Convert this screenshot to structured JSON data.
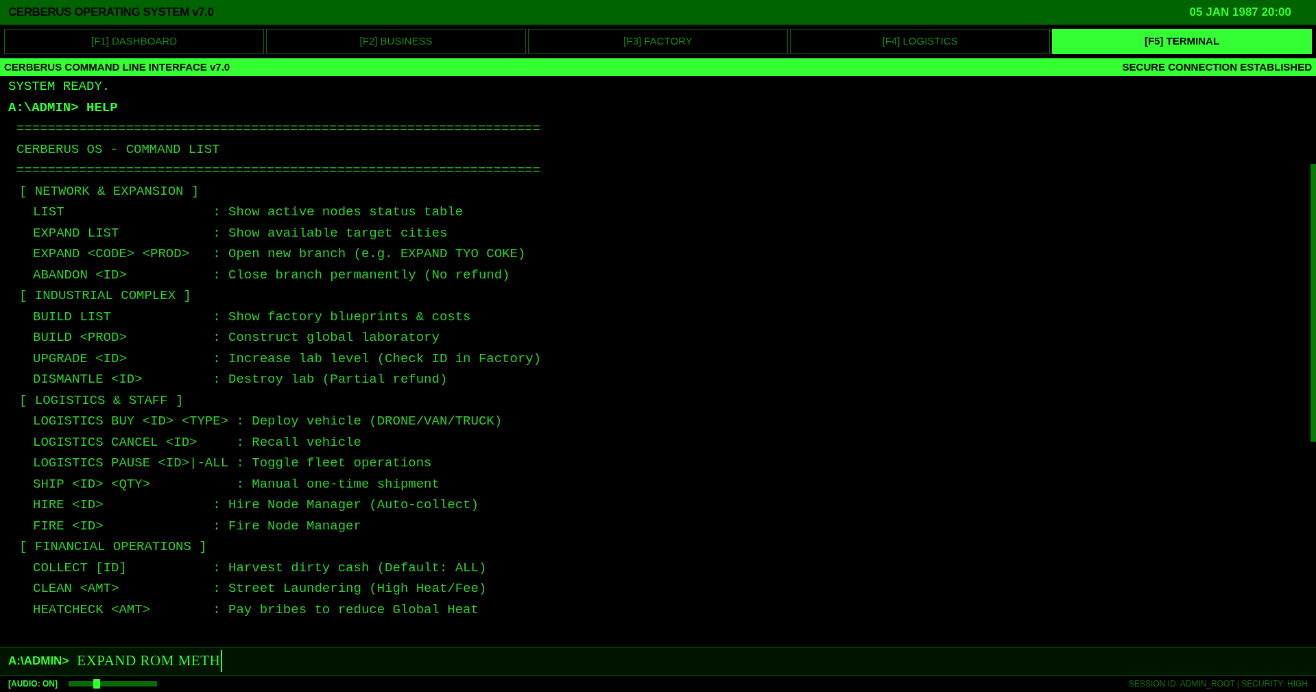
{
  "header": {
    "title": "CERBERUS OPERATING SYSTEM v7.0",
    "datetime": "05 JAN 1987 20:00"
  },
  "tabs": [
    {
      "label": "[F1] DASHBOARD",
      "selected": false
    },
    {
      "label": "[F2] BUSINESS",
      "selected": false
    },
    {
      "label": "[F3] FACTORY",
      "selected": false
    },
    {
      "label": "[F4] LOGISTICS",
      "selected": false
    },
    {
      "label": "[F5] TERMINAL",
      "selected": true
    }
  ],
  "banner": {
    "title": "CERBERUS COMMAND LINE INTERFACE v7.0",
    "status": "SECURE CONNECTION ESTABLISHED"
  },
  "terminal": {
    "lines": [
      {
        "kind": "output",
        "text": "SYSTEM READY."
      },
      {
        "kind": "prompt",
        "text": "A:\\ADMIN> HELP"
      },
      {
        "kind": "rule",
        "text": "==================================================================="
      },
      {
        "kind": "heading",
        "text": "CERBERUS OS - COMMAND LIST"
      },
      {
        "kind": "rule",
        "text": "==================================================================="
      },
      {
        "kind": "section",
        "text": "[ NETWORK & EXPANSION ]"
      },
      {
        "kind": "command",
        "text": "LIST                   : Show active nodes status table"
      },
      {
        "kind": "command",
        "text": "EXPAND LIST            : Show available target cities"
      },
      {
        "kind": "command",
        "text": "EXPAND <CODE> <PROD>   : Open new branch (e.g. EXPAND TYO COKE)"
      },
      {
        "kind": "command",
        "text": "ABANDON <ID>           : Close branch permanently (No refund)"
      },
      {
        "kind": "section",
        "text": "[ INDUSTRIAL COMPLEX ]"
      },
      {
        "kind": "command",
        "text": "BUILD LIST             : Show factory blueprints & costs"
      },
      {
        "kind": "command",
        "text": "BUILD <PROD>           : Construct global laboratory"
      },
      {
        "kind": "command",
        "text": "UPGRADE <ID>           : Increase lab level (Check ID in Factory)"
      },
      {
        "kind": "command",
        "text": "DISMANTLE <ID>         : Destroy lab (Partial refund)"
      },
      {
        "kind": "section",
        "text": "[ LOGISTICS & STAFF ]"
      },
      {
        "kind": "command",
        "text": "LOGISTICS BUY <ID> <TYPE> : Deploy vehicle (DRONE/VAN/TRUCK)"
      },
      {
        "kind": "command",
        "text": "LOGISTICS CANCEL <ID>     : Recall vehicle"
      },
      {
        "kind": "command",
        "text": "LOGISTICS PAUSE <ID>|-ALL : Toggle fleet operations"
      },
      {
        "kind": "command",
        "text": "SHIP <ID> <QTY>           : Manual one-time shipment"
      },
      {
        "kind": "command",
        "text": "HIRE <ID>              : Hire Node Manager (Auto-collect)"
      },
      {
        "kind": "command",
        "text": "FIRE <ID>              : Fire Node Manager"
      },
      {
        "kind": "section",
        "text": "[ FINANCIAL OPERATIONS ]"
      },
      {
        "kind": "command",
        "text": "COLLECT [ID]           : Harvest dirty cash (Default: ALL)"
      },
      {
        "kind": "command",
        "text": "CLEAN <AMT>            : Street Laundering (High Heat/Fee)"
      },
      {
        "kind": "command",
        "text": "HEATCHECK <AMT>        : Pay bribes to reduce Global Heat"
      }
    ]
  },
  "input": {
    "prompt": "A:\\ADMIN>",
    "value": "EXPAND ROM METH"
  },
  "footer": {
    "audio": "[AUDIO: ON]",
    "volume": {
      "level": 0.32
    },
    "session": "SESSION ID: ADMIN_ROOT | SECURITY: HIGH"
  }
}
